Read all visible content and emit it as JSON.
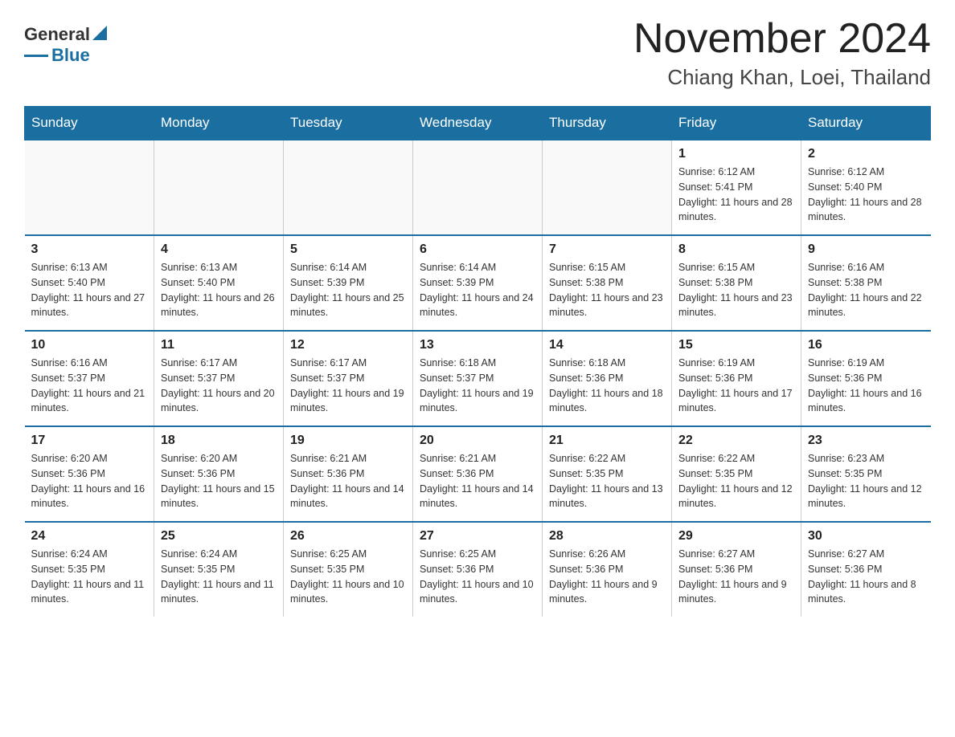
{
  "header": {
    "logo_general": "General",
    "logo_blue": "Blue",
    "month_title": "November 2024",
    "location": "Chiang Khan, Loei, Thailand"
  },
  "weekdays": [
    "Sunday",
    "Monday",
    "Tuesday",
    "Wednesday",
    "Thursday",
    "Friday",
    "Saturday"
  ],
  "weeks": [
    [
      {
        "day": "",
        "sunrise": "",
        "sunset": "",
        "daylight": ""
      },
      {
        "day": "",
        "sunrise": "",
        "sunset": "",
        "daylight": ""
      },
      {
        "day": "",
        "sunrise": "",
        "sunset": "",
        "daylight": ""
      },
      {
        "day": "",
        "sunrise": "",
        "sunset": "",
        "daylight": ""
      },
      {
        "day": "",
        "sunrise": "",
        "sunset": "",
        "daylight": ""
      },
      {
        "day": "1",
        "sunrise": "Sunrise: 6:12 AM",
        "sunset": "Sunset: 5:41 PM",
        "daylight": "Daylight: 11 hours and 28 minutes."
      },
      {
        "day": "2",
        "sunrise": "Sunrise: 6:12 AM",
        "sunset": "Sunset: 5:40 PM",
        "daylight": "Daylight: 11 hours and 28 minutes."
      }
    ],
    [
      {
        "day": "3",
        "sunrise": "Sunrise: 6:13 AM",
        "sunset": "Sunset: 5:40 PM",
        "daylight": "Daylight: 11 hours and 27 minutes."
      },
      {
        "day": "4",
        "sunrise": "Sunrise: 6:13 AM",
        "sunset": "Sunset: 5:40 PM",
        "daylight": "Daylight: 11 hours and 26 minutes."
      },
      {
        "day": "5",
        "sunrise": "Sunrise: 6:14 AM",
        "sunset": "Sunset: 5:39 PM",
        "daylight": "Daylight: 11 hours and 25 minutes."
      },
      {
        "day": "6",
        "sunrise": "Sunrise: 6:14 AM",
        "sunset": "Sunset: 5:39 PM",
        "daylight": "Daylight: 11 hours and 24 minutes."
      },
      {
        "day": "7",
        "sunrise": "Sunrise: 6:15 AM",
        "sunset": "Sunset: 5:38 PM",
        "daylight": "Daylight: 11 hours and 23 minutes."
      },
      {
        "day": "8",
        "sunrise": "Sunrise: 6:15 AM",
        "sunset": "Sunset: 5:38 PM",
        "daylight": "Daylight: 11 hours and 23 minutes."
      },
      {
        "day": "9",
        "sunrise": "Sunrise: 6:16 AM",
        "sunset": "Sunset: 5:38 PM",
        "daylight": "Daylight: 11 hours and 22 minutes."
      }
    ],
    [
      {
        "day": "10",
        "sunrise": "Sunrise: 6:16 AM",
        "sunset": "Sunset: 5:37 PM",
        "daylight": "Daylight: 11 hours and 21 minutes."
      },
      {
        "day": "11",
        "sunrise": "Sunrise: 6:17 AM",
        "sunset": "Sunset: 5:37 PM",
        "daylight": "Daylight: 11 hours and 20 minutes."
      },
      {
        "day": "12",
        "sunrise": "Sunrise: 6:17 AM",
        "sunset": "Sunset: 5:37 PM",
        "daylight": "Daylight: 11 hours and 19 minutes."
      },
      {
        "day": "13",
        "sunrise": "Sunrise: 6:18 AM",
        "sunset": "Sunset: 5:37 PM",
        "daylight": "Daylight: 11 hours and 19 minutes."
      },
      {
        "day": "14",
        "sunrise": "Sunrise: 6:18 AM",
        "sunset": "Sunset: 5:36 PM",
        "daylight": "Daylight: 11 hours and 18 minutes."
      },
      {
        "day": "15",
        "sunrise": "Sunrise: 6:19 AM",
        "sunset": "Sunset: 5:36 PM",
        "daylight": "Daylight: 11 hours and 17 minutes."
      },
      {
        "day": "16",
        "sunrise": "Sunrise: 6:19 AM",
        "sunset": "Sunset: 5:36 PM",
        "daylight": "Daylight: 11 hours and 16 minutes."
      }
    ],
    [
      {
        "day": "17",
        "sunrise": "Sunrise: 6:20 AM",
        "sunset": "Sunset: 5:36 PM",
        "daylight": "Daylight: 11 hours and 16 minutes."
      },
      {
        "day": "18",
        "sunrise": "Sunrise: 6:20 AM",
        "sunset": "Sunset: 5:36 PM",
        "daylight": "Daylight: 11 hours and 15 minutes."
      },
      {
        "day": "19",
        "sunrise": "Sunrise: 6:21 AM",
        "sunset": "Sunset: 5:36 PM",
        "daylight": "Daylight: 11 hours and 14 minutes."
      },
      {
        "day": "20",
        "sunrise": "Sunrise: 6:21 AM",
        "sunset": "Sunset: 5:36 PM",
        "daylight": "Daylight: 11 hours and 14 minutes."
      },
      {
        "day": "21",
        "sunrise": "Sunrise: 6:22 AM",
        "sunset": "Sunset: 5:35 PM",
        "daylight": "Daylight: 11 hours and 13 minutes."
      },
      {
        "day": "22",
        "sunrise": "Sunrise: 6:22 AM",
        "sunset": "Sunset: 5:35 PM",
        "daylight": "Daylight: 11 hours and 12 minutes."
      },
      {
        "day": "23",
        "sunrise": "Sunrise: 6:23 AM",
        "sunset": "Sunset: 5:35 PM",
        "daylight": "Daylight: 11 hours and 12 minutes."
      }
    ],
    [
      {
        "day": "24",
        "sunrise": "Sunrise: 6:24 AM",
        "sunset": "Sunset: 5:35 PM",
        "daylight": "Daylight: 11 hours and 11 minutes."
      },
      {
        "day": "25",
        "sunrise": "Sunrise: 6:24 AM",
        "sunset": "Sunset: 5:35 PM",
        "daylight": "Daylight: 11 hours and 11 minutes."
      },
      {
        "day": "26",
        "sunrise": "Sunrise: 6:25 AM",
        "sunset": "Sunset: 5:35 PM",
        "daylight": "Daylight: 11 hours and 10 minutes."
      },
      {
        "day": "27",
        "sunrise": "Sunrise: 6:25 AM",
        "sunset": "Sunset: 5:36 PM",
        "daylight": "Daylight: 11 hours and 10 minutes."
      },
      {
        "day": "28",
        "sunrise": "Sunrise: 6:26 AM",
        "sunset": "Sunset: 5:36 PM",
        "daylight": "Daylight: 11 hours and 9 minutes."
      },
      {
        "day": "29",
        "sunrise": "Sunrise: 6:27 AM",
        "sunset": "Sunset: 5:36 PM",
        "daylight": "Daylight: 11 hours and 9 minutes."
      },
      {
        "day": "30",
        "sunrise": "Sunrise: 6:27 AM",
        "sunset": "Sunset: 5:36 PM",
        "daylight": "Daylight: 11 hours and 8 minutes."
      }
    ]
  ]
}
